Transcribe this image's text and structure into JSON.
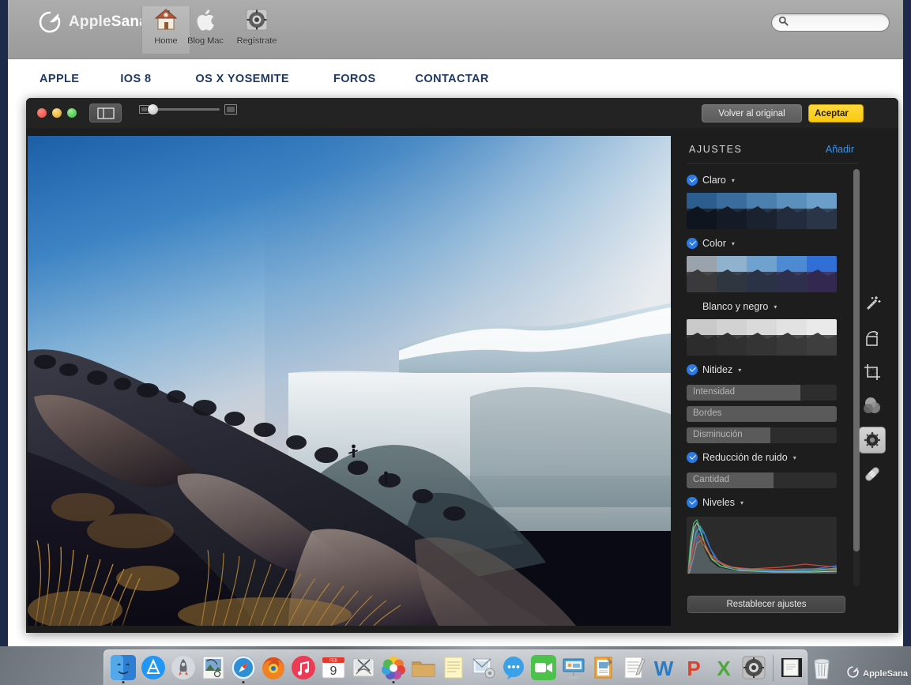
{
  "site": {
    "brand": {
      "name_light": "Apple",
      "name_bold": "Sana",
      "logo_icon": "leaf-circle-logo"
    },
    "header_items": [
      {
        "label": "Home",
        "icon": "house-icon",
        "active": true
      },
      {
        "label": "Blog Mac",
        "icon": "apple-logo-icon",
        "active": false
      },
      {
        "label": "Regístrate",
        "icon": "gear-badge-icon",
        "active": false
      }
    ],
    "search": {
      "placeholder": "",
      "value": "",
      "icon": "search-icon"
    },
    "nav": [
      {
        "label": "APPLE"
      },
      {
        "label": "IOS 8"
      },
      {
        "label": "OS X YOSEMITE"
      },
      {
        "label": "FOROS"
      },
      {
        "label": "CONTACTAR"
      }
    ],
    "nav_color": "#1f3864"
  },
  "window": {
    "traffic_lights": [
      "close",
      "minimize",
      "zoom"
    ],
    "toolbar": {
      "segment_icon": "split-view-icon",
      "zoom_small_icon": "small-thumbnail-icon",
      "zoom_large_icon": "large-thumbnail-icon",
      "zoom_value": 0,
      "revert_label": "Volver al original",
      "accept_label": "Aceptar"
    }
  },
  "panel": {
    "title": "AJUSTES",
    "add_label": "Añadir",
    "reset_label": "Restablecer ajustes",
    "accent": "#2a7ae2",
    "sections": [
      {
        "name": "Claro",
        "checked": true,
        "caret": "▾",
        "type": "thumbnails",
        "selected_index": 3,
        "thumbnails": 5
      },
      {
        "name": "Color",
        "checked": true,
        "caret": "▾",
        "type": "thumbnails",
        "selected_index": 3,
        "thumbnails": 5
      },
      {
        "name": "Blanco y negro",
        "checked": false,
        "caret": "▾",
        "type": "thumbnails",
        "selected_index": -1,
        "thumbnails": 5
      },
      {
        "name": "Nitidez",
        "checked": true,
        "caret": "▾",
        "type": "sliders",
        "sliders": [
          {
            "label": "Intensidad",
            "fill_pct": 76
          },
          {
            "label": "Bordes",
            "fill_pct": 100
          },
          {
            "label": "Disminución",
            "fill_pct": 56
          }
        ]
      },
      {
        "name": "Reducción de ruido",
        "checked": true,
        "caret": "▾",
        "type": "sliders",
        "sliders": [
          {
            "label": "Cantidad",
            "fill_pct": 58
          }
        ]
      },
      {
        "name": "Niveles",
        "checked": true,
        "caret": "▾",
        "type": "histogram",
        "histogram_channels": [
          "green",
          "cyan",
          "blue",
          "red",
          "luminance"
        ]
      }
    ]
  },
  "tools": [
    {
      "name": "enhance-wand-icon",
      "label": "Mejorar",
      "active": false
    },
    {
      "name": "rotate-icon",
      "label": "Girar",
      "active": false
    },
    {
      "name": "crop-icon",
      "label": "Recortar",
      "active": false
    },
    {
      "name": "filters-icon",
      "label": "Filtros",
      "active": false
    },
    {
      "name": "adjust-icon",
      "label": "Ajustar",
      "active": true
    },
    {
      "name": "retouch-bandaid-icon",
      "label": "Retocar",
      "active": false
    }
  ],
  "photo": {
    "alt": "Paisaje de montaña al amanecer con niebla",
    "description": "mountain-sunrise-landscape"
  },
  "dock": {
    "items": [
      {
        "name": "finder",
        "running": true
      },
      {
        "name": "app-store",
        "running": false
      },
      {
        "name": "launchpad",
        "running": false
      },
      {
        "name": "preview",
        "running": false
      },
      {
        "name": "safari",
        "running": true
      },
      {
        "name": "firefox",
        "running": false
      },
      {
        "name": "itunes",
        "running": false
      },
      {
        "name": "calendar",
        "running": false,
        "day": "9",
        "month": "FEB"
      },
      {
        "name": "photo-booth",
        "running": false
      },
      {
        "name": "photos",
        "running": true
      },
      {
        "name": "folder",
        "running": false
      },
      {
        "name": "stickies",
        "running": false
      },
      {
        "name": "mail",
        "running": false
      },
      {
        "name": "messages",
        "running": false
      },
      {
        "name": "facetime",
        "running": false
      },
      {
        "name": "keynote",
        "running": false
      },
      {
        "name": "pages",
        "running": false
      },
      {
        "name": "textedit",
        "running": false
      },
      {
        "name": "word",
        "running": false
      },
      {
        "name": "powerpoint",
        "running": false
      },
      {
        "name": "excel",
        "running": false
      },
      {
        "name": "system-preferences",
        "running": false
      },
      {
        "name": "separator",
        "running": false
      },
      {
        "name": "document",
        "running": false
      },
      {
        "name": "trash",
        "running": false
      }
    ]
  },
  "watermark": {
    "text_light": "Apple",
    "text_bold": "Sana"
  }
}
